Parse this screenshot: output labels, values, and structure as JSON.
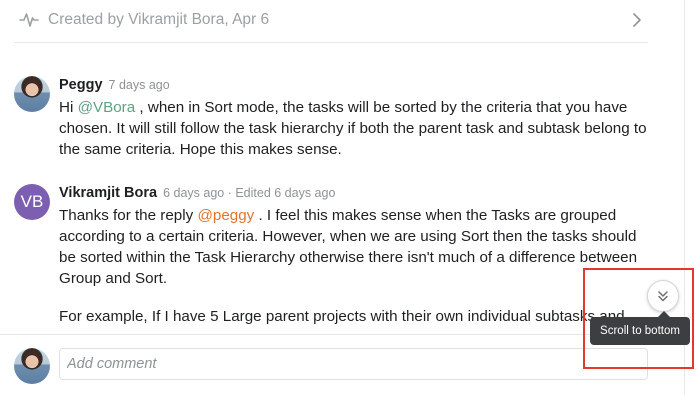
{
  "activity": {
    "text": "Created by Vikramjit Bora, Apr 6"
  },
  "comments": [
    {
      "author": "Peggy",
      "meta": "7 days ago",
      "body": {
        "prefix": "Hi ",
        "mention": "@VBora",
        "rest": " , when in Sort mode, the tasks will be sorted by the criteria that you have chosen. It will still follow the task hierarchy if both the parent task and subtask belong to the same criteria. Hope this makes sense."
      }
    },
    {
      "author": "Vikramjit Bora",
      "avatar_initials": "VB",
      "meta": "6 days ago · Edited 6 days ago",
      "body": {
        "prefix": "Thanks for the reply ",
        "mention": "@peggy",
        "rest": " . I feel this makes sense when the Tasks are grouped according to a certain criteria. However, when we are using Sort then the tasks should be sorted within the Task Hierarchy otherwise there isn't much of a difference between Group and Sort.",
        "paragraph2": "For example, If I have 5 Large parent projects with their own individual subtasks and"
      }
    }
  ],
  "composer": {
    "placeholder": "Add comment"
  },
  "scroll_tooltip": "Scroll to bottom",
  "colors": {
    "mention_green": "#5da283",
    "mention_orange": "#e0752e",
    "avatar_vb": "#7c5fb0",
    "highlight": "#e13a2a"
  }
}
